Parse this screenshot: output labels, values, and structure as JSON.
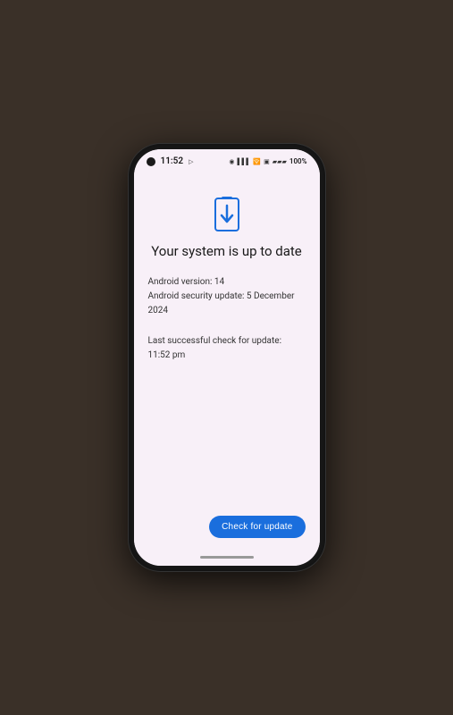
{
  "phone": {
    "status_bar": {
      "time": "11:52",
      "battery_percent": "100%"
    },
    "content": {
      "main_title": "Your system is up to date",
      "android_version_label": "Android version: 14",
      "security_update_label": "Android security update: 5 December 2024",
      "last_check_label": "Last successful check for update:",
      "last_check_time": "11:52 pm",
      "check_button_label": "Check for update"
    },
    "colors": {
      "accent_blue": "#1a6edd",
      "bg": "#f8f0f8",
      "text_primary": "#1a1a1a",
      "text_secondary": "#333333"
    }
  }
}
